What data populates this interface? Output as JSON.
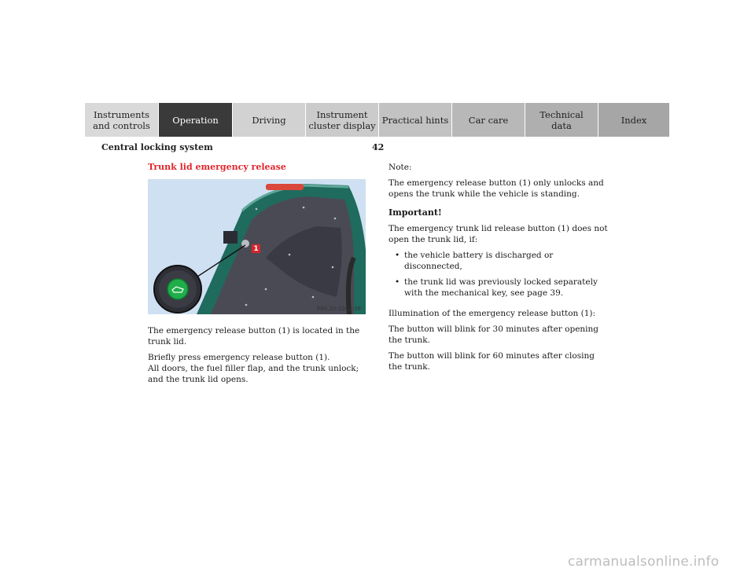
{
  "nav": {
    "tabs": [
      {
        "label": "Instruments\nand controls",
        "active": false
      },
      {
        "label": "Operation",
        "active": true
      },
      {
        "label": "Driving",
        "active": false
      },
      {
        "label": "Instrument\ncluster display",
        "active": false
      },
      {
        "label": "Practical hints",
        "active": false
      },
      {
        "label": "Car care",
        "active": false
      },
      {
        "label": "Technical\ndata",
        "active": false
      },
      {
        "label": "Index",
        "active": false
      }
    ],
    "active_color": "#3a3a3a"
  },
  "header": {
    "section_title": "Central locking system",
    "page_number": "42"
  },
  "left": {
    "heading": "Trunk lid emergency release",
    "figure": {
      "code": "P80.20-2262-26",
      "callout": "1"
    },
    "p1": "The emergency release button (1) is located in the trunk lid.",
    "p2": "Briefly press emergency release button (1).",
    "p3": "All doors, the fuel filler flap, and the trunk unlock; and the trunk lid opens."
  },
  "right": {
    "note_label": "Note:",
    "note_text": "The emergency release button (1) only unlocks and opens the trunk while the vehicle is standing.",
    "important_label": "Important!",
    "important_text": "The emergency trunk lid release button (1) does not open the trunk lid, if:",
    "bullets": [
      "the vehicle battery is discharged or disconnected,",
      "the trunk lid was previously locked separately with the mechanical key, see page 39."
    ],
    "illum_label": "Illumination of the emergency release button (1):",
    "illum_1": "The button will blink for 30 minutes after opening the trunk.",
    "illum_2": "The button will blink for 60 minutes after closing the trunk."
  },
  "footer": {
    "watermark": "carmanualsonline.info"
  },
  "colors": {
    "heading": "#e0262c",
    "trunk_green": "#1f6b5e",
    "button_green": "#1fae4a",
    "liner": "#4a4a55",
    "sky": "#cfe0f2"
  }
}
